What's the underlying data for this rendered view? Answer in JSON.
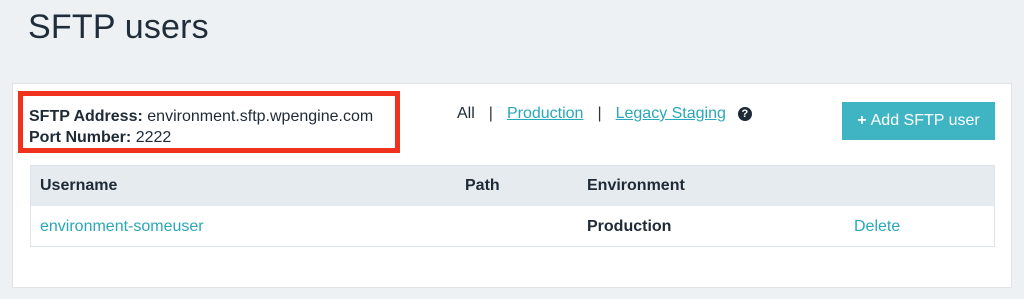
{
  "page": {
    "title": "SFTP users"
  },
  "sftp": {
    "address_label": "SFTP Address:",
    "address_value": "environment.sftp.wpengine.com",
    "port_label": "Port Number:",
    "port_value": "2222"
  },
  "filters": {
    "all": "All",
    "production": "Production",
    "legacy_staging": "Legacy Staging",
    "separator": "|",
    "help_glyph": "?"
  },
  "actions": {
    "add_label": "Add SFTP user",
    "add_icon": "+"
  },
  "table": {
    "headers": {
      "username": "Username",
      "path": "Path",
      "environment": "Environment"
    },
    "rows": [
      {
        "username": "environment-someuser",
        "path": "",
        "environment": "Production",
        "action": "Delete"
      }
    ]
  },
  "colors": {
    "accent": "#3fb5c4",
    "link": "#2aa7b8",
    "highlight": "#f0311e"
  }
}
